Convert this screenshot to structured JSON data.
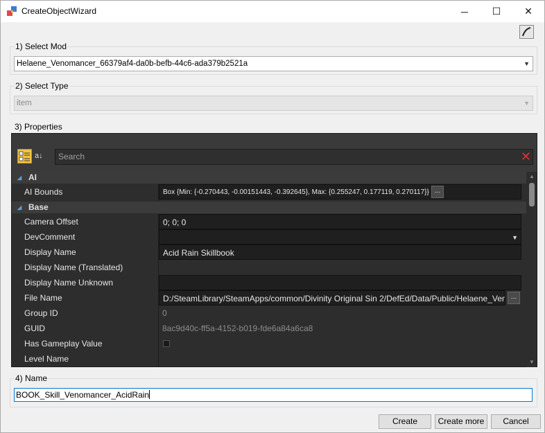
{
  "window": {
    "title": "CreateObjectWizard",
    "minimize_glyph": "─",
    "maximize_glyph": "☐",
    "close_glyph": "✕",
    "icon": "app-window-icon"
  },
  "toolbar": {
    "edit_icon": "pen-icon"
  },
  "select_mod": {
    "label": "1) Select Mod",
    "value": "Helaene_Venomancer_66379af4-da0b-befb-44c6-ada379b2521a"
  },
  "select_type": {
    "label": "2) Select Type",
    "value": "item"
  },
  "properties": {
    "label": "3) Properties",
    "search_placeholder": "Search",
    "sort_glyph": "a↓",
    "clear_glyph": "✕",
    "categories": [
      {
        "name": "AI"
      },
      {
        "name": "Base"
      }
    ],
    "ai_rows": [
      {
        "name": "AI Bounds",
        "value": "Box {Min: {-0.270443, -0.00151443, -0.392645}, Max: {0.255247, 0.177119, 0.270117}}"
      }
    ],
    "base_rows": [
      {
        "name": "Camera Offset",
        "value": "0; 0; 0"
      },
      {
        "name": "DevComment",
        "value": ""
      },
      {
        "name": "Display Name",
        "value": "Acid Rain Skillbook"
      },
      {
        "name": "Display Name (Translated)",
        "value": ""
      },
      {
        "name": "Display Name Unknown",
        "value": ""
      },
      {
        "name": "File Name",
        "value": "D:/SteamLibrary/SteamApps/common/Divinity Original Sin 2/DefEd/Data/Public/Helaene_Venomancer"
      },
      {
        "name": "Group ID",
        "value": "0"
      },
      {
        "name": "GUID",
        "value": "8ac9d40c-ff5a-4152-b019-fde6a84a6ca8"
      },
      {
        "name": "Has Gameplay Value",
        "value": ""
      },
      {
        "name": "Level Name",
        "value": ""
      }
    ],
    "ellipsis_label": "..."
  },
  "name_section": {
    "label": "4) Name",
    "value": "BOOK_Skill_Venomancer_AcidRain"
  },
  "buttons": {
    "create": "Create",
    "create_more": "Create more",
    "cancel": "Cancel"
  }
}
